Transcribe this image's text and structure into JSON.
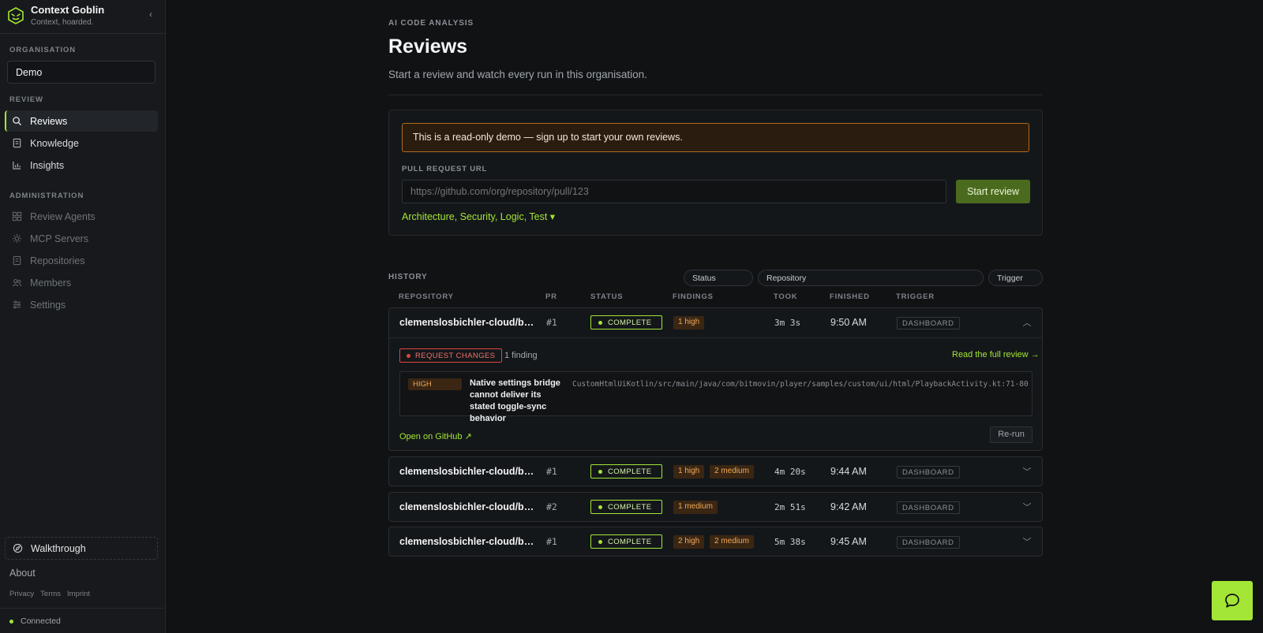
{
  "brand": {
    "name": "Context Goblin",
    "tagline": "Context, hoarded."
  },
  "sidebar": {
    "org_label": "ORGANISATION",
    "org_value": "Demo",
    "review_label": "REVIEW",
    "review_items": [
      {
        "label": "Reviews",
        "icon": "search-icon",
        "active": true
      },
      {
        "label": "Knowledge",
        "icon": "book-icon"
      },
      {
        "label": "Insights",
        "icon": "chart-icon"
      }
    ],
    "admin_label": "ADMINISTRATION",
    "admin_items": [
      {
        "label": "Review Agents",
        "icon": "grid-icon"
      },
      {
        "label": "MCP Servers",
        "icon": "server-icon"
      },
      {
        "label": "Repositories",
        "icon": "repo-icon"
      },
      {
        "label": "Members",
        "icon": "users-icon"
      },
      {
        "label": "Settings",
        "icon": "sliders-icon"
      }
    ],
    "walkthrough": "Walkthrough",
    "about": "About",
    "legal": [
      "Privacy",
      "Terms",
      "Imprint"
    ],
    "connection_status": "Connected"
  },
  "header": {
    "eyebrow": "AI CODE ANALYSIS",
    "title": "Reviews",
    "subtitle": "Start a review and watch every run in this organisation."
  },
  "start_card": {
    "banner": "This is a read-only demo — sign up to start your own reviews.",
    "url_label": "PULL REQUEST URL",
    "url_placeholder": "https://github.com/org/repository/pull/123",
    "start_button": "Start review",
    "agents_link": "Architecture, Security, Logic, Test ▾"
  },
  "history": {
    "label": "HISTORY",
    "filters": {
      "status": "Status",
      "repository": "Repository",
      "trigger": "Trigger"
    },
    "columns": [
      "REPOSITORY",
      "PR",
      "STATUS",
      "FINDINGS",
      "TOOK",
      "FINISHED",
      "TRIGGER"
    ],
    "rows": [
      {
        "repo": "clemenslosbichler-cloud/bitmovin-player-web-samples",
        "pr": "#1",
        "status": "COMPLETE",
        "findings": [
          "1 high"
        ],
        "took": "3m 3s",
        "finished": "9:50 AM",
        "trigger": "DASHBOARD",
        "expanded": true,
        "verdict": "REQUEST CHANGES",
        "finding_count": "1 finding",
        "read_full": "Read the full review →",
        "finding": {
          "severity": "HIGH",
          "title": "Native settings bridge cannot deliver its stated toggle-sync behavior",
          "path": "CustomHtmlUiKotlin/src/main/java/com/bitmovin/player/samples/custom/ui/html/PlaybackActivity.kt:71-80"
        },
        "github_link": "Open on GitHub ↗",
        "rerun": "Re-run"
      },
      {
        "repo": "clemenslosbichler-cloud/bitmovin-player-web-samples",
        "pr": "#1",
        "status": "COMPLETE",
        "findings": [
          "1 high",
          "2 medium"
        ],
        "took": "4m 20s",
        "finished": "9:44 AM",
        "trigger": "DASHBOARD"
      },
      {
        "repo": "clemenslosbichler-cloud/bitmovin-player-web-samples",
        "pr": "#2",
        "status": "COMPLETE",
        "findings": [
          "1 medium"
        ],
        "took": "2m 51s",
        "finished": "9:42 AM",
        "trigger": "DASHBOARD"
      },
      {
        "repo": "clemenslosbichler-cloud/bitmovin-player-web-samples",
        "pr": "#1",
        "status": "COMPLETE",
        "findings": [
          "2 high",
          "2 medium"
        ],
        "took": "5m 38s",
        "finished": "9:45 AM",
        "trigger": "DASHBOARD"
      }
    ]
  },
  "colors": {
    "accent": "#a3e635",
    "danger": "#e0443a",
    "warning": "#f0a959",
    "background": "#101214"
  }
}
